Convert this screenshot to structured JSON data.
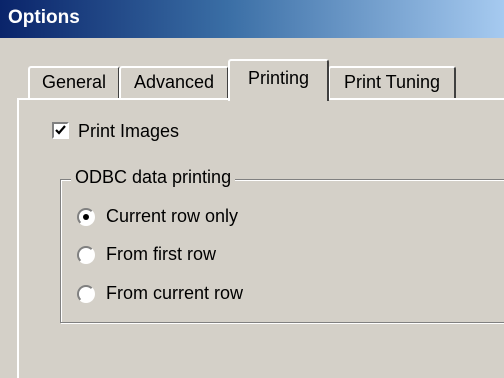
{
  "window": {
    "title": "Options"
  },
  "tabs": [
    {
      "label": "General",
      "selected": false
    },
    {
      "label": "Advanced",
      "selected": false
    },
    {
      "label": "Printing",
      "selected": true
    },
    {
      "label": "Print Tuning",
      "selected": false
    }
  ],
  "printing": {
    "print_images": {
      "label": "Print Images",
      "checked": true
    },
    "odbc_group": {
      "legend": "ODBC data printing",
      "options": [
        {
          "label": "Current row only",
          "selected": true
        },
        {
          "label": "From first row",
          "selected": false
        },
        {
          "label": "From current row",
          "selected": false
        }
      ]
    }
  },
  "colors": {
    "title_gradient_start": "#0a246a",
    "title_gradient_end": "#a6caf0",
    "dialog_face": "#d4d0c8"
  }
}
